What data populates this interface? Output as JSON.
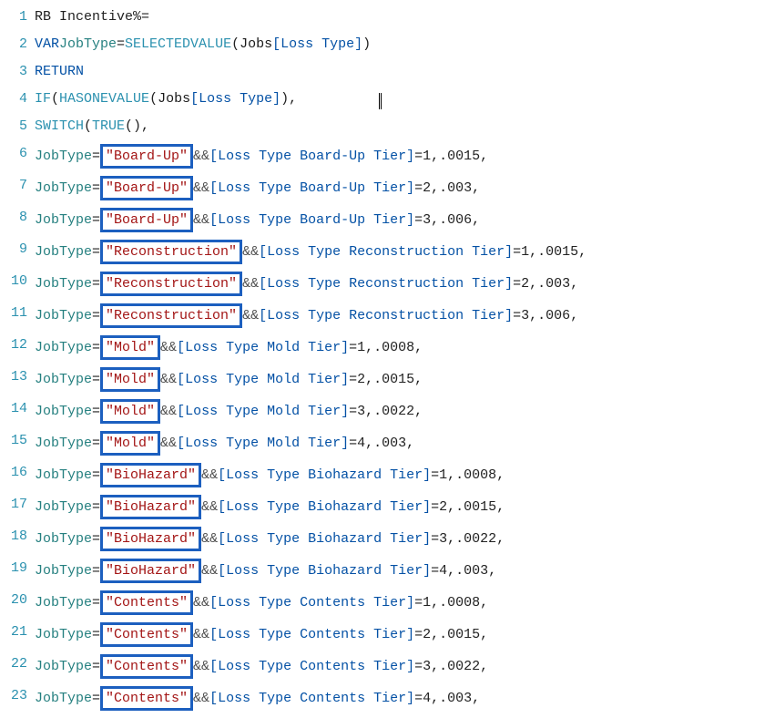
{
  "measure_name": "RB Incentive%",
  "keywords": {
    "var": "VAR",
    "return": "RETURN",
    "if": "IF",
    "switch": "SWITCH",
    "true": "TRUE"
  },
  "funcs": {
    "selectedvalue": "SELECTEDVALUE",
    "hasonevalue": "HASONEVALUE"
  },
  "table": "Jobs",
  "column": "[Loss Type]",
  "var_name": "JobType",
  "eq": "=",
  "amp": "&&",
  "lines": [
    {
      "n": 1,
      "type": "header"
    },
    {
      "n": 2,
      "type": "vardef"
    },
    {
      "n": 3,
      "type": "return"
    },
    {
      "n": 4,
      "type": "ifline",
      "cursor": true
    },
    {
      "n": 5,
      "type": "switchline"
    },
    {
      "n": 6,
      "type": "case",
      "str": "\"Board-Up\"",
      "col": "[Loss Type Board-Up Tier]",
      "tier": "1",
      "val": ".0015"
    },
    {
      "n": 7,
      "type": "case",
      "str": "\"Board-Up\"",
      "col": "[Loss Type Board-Up Tier]",
      "tier": "2",
      "val": ".003"
    },
    {
      "n": 8,
      "type": "case",
      "str": "\"Board-Up\"",
      "col": "[Loss Type Board-Up Tier]",
      "tier": "3",
      "val": ".006"
    },
    {
      "n": 9,
      "type": "case",
      "str": "\"Reconstruction\"",
      "col": "[Loss Type Reconstruction Tier]",
      "tier": "1",
      "val": ".0015"
    },
    {
      "n": 10,
      "type": "case",
      "str": "\"Reconstruction\"",
      "col": "[Loss Type Reconstruction Tier]",
      "tier": "2",
      "val": ".003"
    },
    {
      "n": 11,
      "type": "case",
      "str": "\"Reconstruction\"",
      "col": "[Loss Type Reconstruction Tier]",
      "tier": "3",
      "val": ".006"
    },
    {
      "n": 12,
      "type": "case",
      "str": "\"Mold\"",
      "col": "[Loss Type Mold Tier]",
      "tier": "1",
      "val": ".0008"
    },
    {
      "n": 13,
      "type": "case",
      "str": "\"Mold\"",
      "col": "[Loss Type Mold Tier]",
      "tier": "2",
      "val": ".0015"
    },
    {
      "n": 14,
      "type": "case",
      "str": "\"Mold\"",
      "col": "[Loss Type Mold Tier]",
      "tier": "3",
      "val": ".0022"
    },
    {
      "n": 15,
      "type": "case",
      "str": "\"Mold\"",
      "col": "[Loss Type Mold Tier]",
      "tier": "4",
      "val": ".003"
    },
    {
      "n": 16,
      "type": "case",
      "str": "\"BioHazard\"",
      "col": "[Loss Type Biohazard Tier]",
      "tier": "1",
      "val": ".0008"
    },
    {
      "n": 17,
      "type": "case",
      "str": "\"BioHazard\"",
      "col": "[Loss Type Biohazard Tier]",
      "tier": "2",
      "val": ".0015"
    },
    {
      "n": 18,
      "type": "case",
      "str": "\"BioHazard\"",
      "col": "[Loss Type Biohazard Tier]",
      "tier": "3",
      "val": ".0022"
    },
    {
      "n": 19,
      "type": "case",
      "str": "\"BioHazard\"",
      "col": "[Loss Type Biohazard Tier]",
      "tier": "4",
      "val": ".003"
    },
    {
      "n": 20,
      "type": "case",
      "str": "\"Contents\"",
      "col": "[Loss Type Contents Tier]",
      "tier": "1",
      "val": ".0008"
    },
    {
      "n": 21,
      "type": "case",
      "str": "\"Contents\"",
      "col": "[Loss Type Contents Tier]",
      "tier": "2",
      "val": ".0015"
    },
    {
      "n": 22,
      "type": "case",
      "str": "\"Contents\"",
      "col": "[Loss Type Contents Tier]",
      "tier": "3",
      "val": ".0022"
    },
    {
      "n": 23,
      "type": "case",
      "str": "\"Contents\"",
      "col": "[Loss Type Contents Tier]",
      "tier": "4",
      "val": ".003"
    }
  ]
}
